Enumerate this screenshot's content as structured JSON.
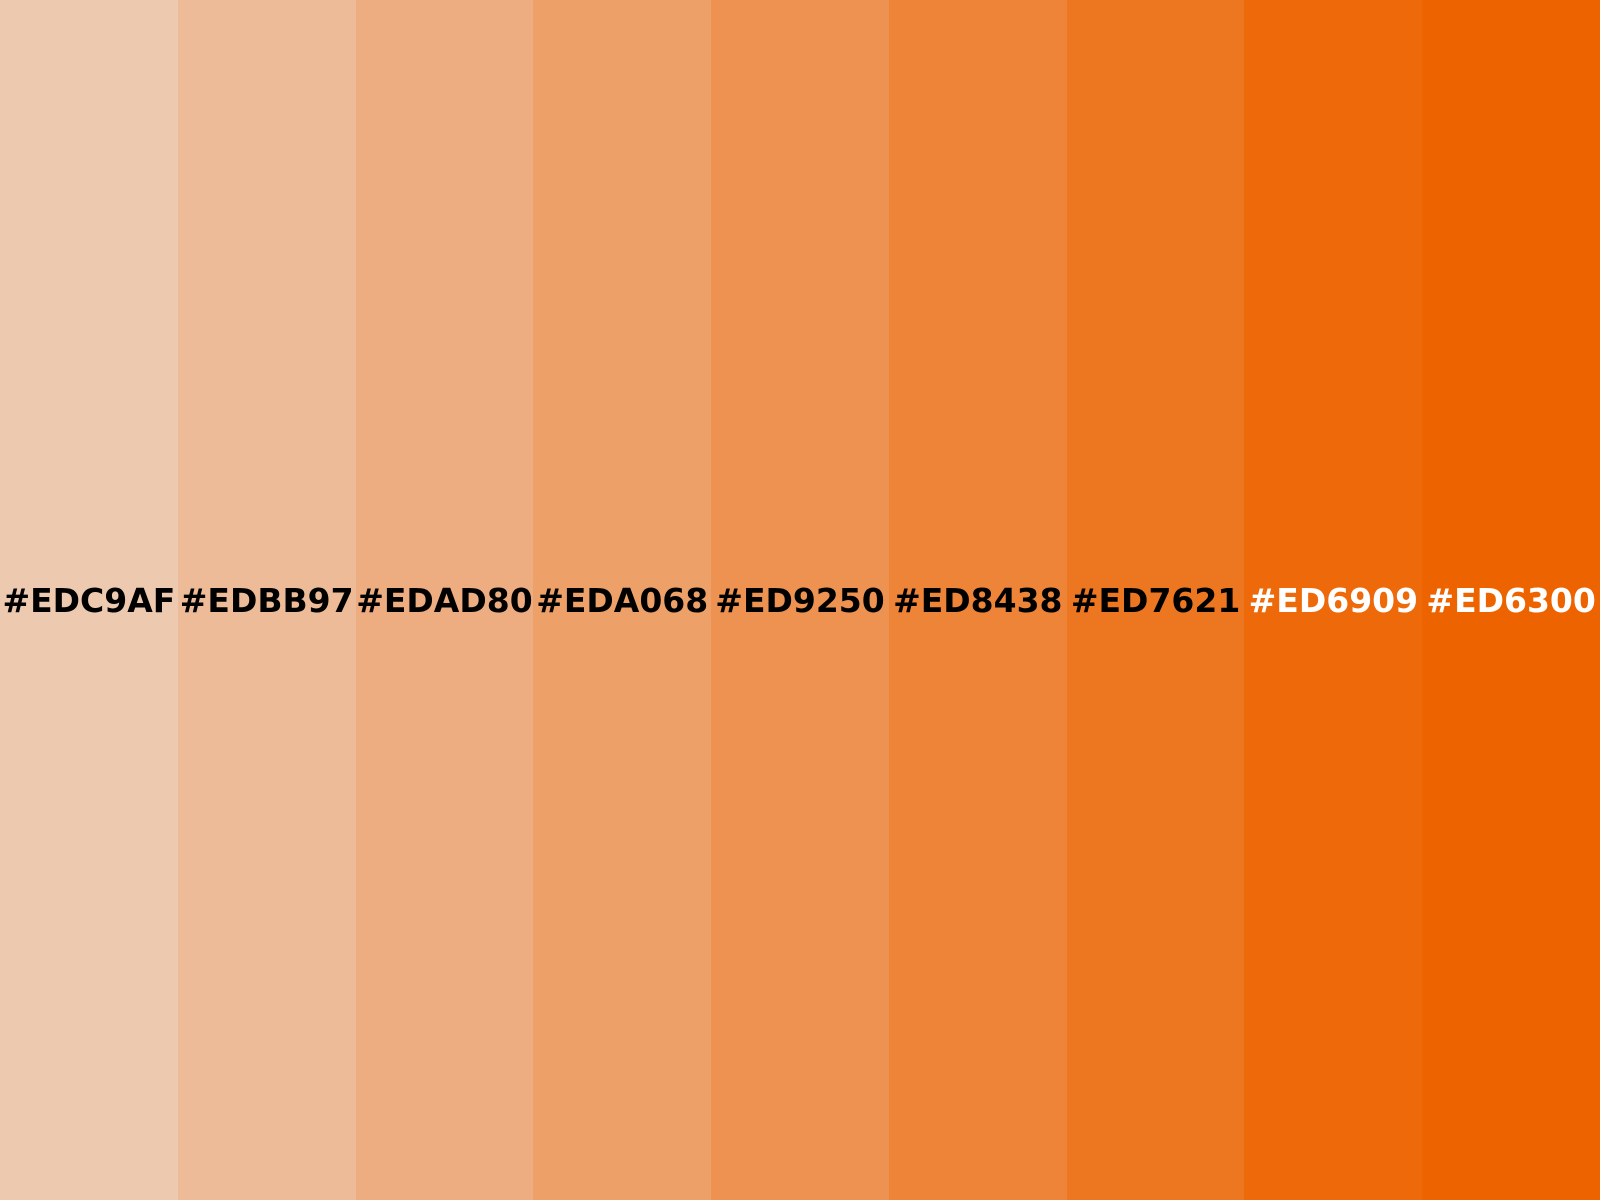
{
  "swatches": [
    {
      "hex": "#EDC9AF",
      "label": "#EDC9AF",
      "text_color": "#000000"
    },
    {
      "hex": "#EDBB97",
      "label": "#EDBB97",
      "text_color": "#000000"
    },
    {
      "hex": "#EDAD80",
      "label": "#EDAD80",
      "text_color": "#000000"
    },
    {
      "hex": "#EDA068",
      "label": "#EDA068",
      "text_color": "#000000"
    },
    {
      "hex": "#ED9250",
      "label": "#ED9250",
      "text_color": "#000000"
    },
    {
      "hex": "#ED8438",
      "label": "#ED8438",
      "text_color": "#000000"
    },
    {
      "hex": "#ED7621",
      "label": "#ED7621",
      "text_color": "#000000"
    },
    {
      "hex": "#ED6909",
      "label": "#ED6909",
      "text_color": "#FFFFFF"
    },
    {
      "hex": "#ED6300",
      "label": "#ED6300",
      "text_color": "#FFFFFF"
    }
  ]
}
